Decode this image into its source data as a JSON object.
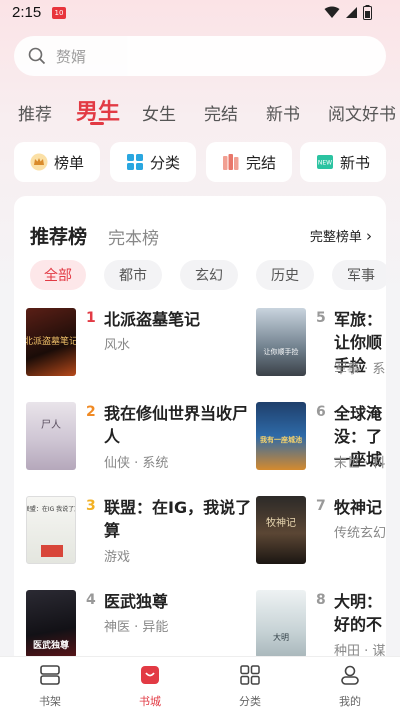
{
  "status": {
    "time": "2:15",
    "badge": "10"
  },
  "search": {
    "placeholder": "赘婿"
  },
  "tabs": [
    "推荐",
    "男生",
    "女生",
    "完结",
    "新书",
    "阅文好书"
  ],
  "quick": [
    {
      "label": "榜单",
      "icon": "crown-icon"
    },
    {
      "label": "分类",
      "icon": "grid-icon"
    },
    {
      "label": "完结",
      "icon": "books-icon"
    },
    {
      "label": "新书",
      "icon": "new-icon"
    }
  ],
  "rank": {
    "tab_active": "推荐榜",
    "tab_other": "完本榜",
    "more": "完整榜单",
    "filters": [
      "全部",
      "都市",
      "玄幻",
      "历史",
      "军事"
    ]
  },
  "books": [
    {
      "rank": "1",
      "title": "北派盗墓笔记",
      "meta": "风水",
      "cover": "北派盗墓笔记"
    },
    {
      "rank": "2",
      "title": "我在修仙世界当收尸人",
      "meta": "仙侠 · 系统",
      "cover": "尸人"
    },
    {
      "rank": "3",
      "title": "联盟：在IG，我说了算",
      "meta": "游戏",
      "cover": "联盟：在IG 我说了算"
    },
    {
      "rank": "4",
      "title": "医武独尊",
      "meta": "神医 · 异能",
      "cover": "医武独尊"
    },
    {
      "rank": "5",
      "title": "军旅：让你顺手捡",
      "meta": "军事 · 系",
      "cover": "让你顺手捡"
    },
    {
      "rank": "6",
      "title": "全球淹没：了一座城",
      "meta": "末世 · 科",
      "cover": "我有一座城池"
    },
    {
      "rank": "7",
      "title": "牧神记",
      "meta": "传统玄幻",
      "cover": "牧神记"
    },
    {
      "rank": "8",
      "title": "大明：好的不",
      "meta": "种田 · 谋",
      "cover": "大明"
    }
  ],
  "nav": [
    {
      "label": "书架",
      "icon": "bookshelf-icon"
    },
    {
      "label": "书城",
      "icon": "bookstore-icon"
    },
    {
      "label": "分类",
      "icon": "category-grid-icon"
    },
    {
      "label": "我的",
      "icon": "profile-icon"
    }
  ],
  "colors": {
    "accent": "#e23a44",
    "rank_top": "#e23a44",
    "rank_2": "#f08a24",
    "rank_3": "#f2b124",
    "rank_other": "#999999"
  }
}
